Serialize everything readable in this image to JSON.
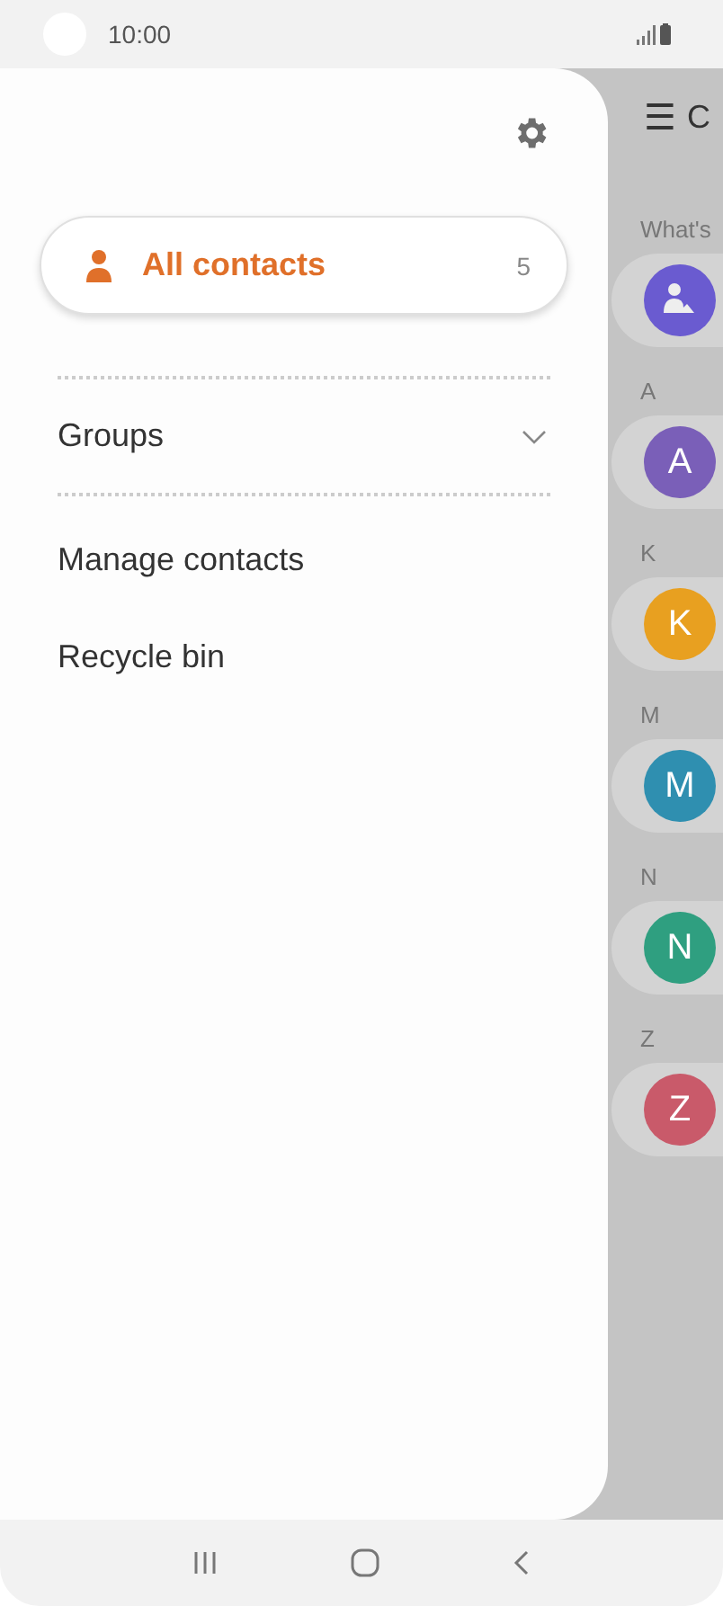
{
  "status_bar": {
    "time": "10:00"
  },
  "drawer": {
    "items": [
      {
        "kind": "main",
        "label": "All contacts",
        "count": "5",
        "selected": true
      },
      {
        "kind": "expandable",
        "label": "Groups",
        "expanded": false,
        "selected": false
      },
      {
        "kind": "plain",
        "label": "Manage contacts",
        "selected": false
      },
      {
        "kind": "plain",
        "label": "Recycle bin",
        "selected": false
      }
    ]
  },
  "contact_list": {
    "menu_icon": "☰",
    "title": "C",
    "sections": [
      {
        "header": "What's",
        "contacts": [
          {
            "kind": "group",
            "color": "#6a5bd0"
          }
        ]
      },
      {
        "header": "A",
        "contacts": [
          {
            "kind": "person",
            "initial": "A",
            "color": "#7a5fb8"
          }
        ]
      },
      {
        "header": "K",
        "contacts": [
          {
            "kind": "person",
            "initial": "K",
            "color": "#e8a020"
          }
        ]
      },
      {
        "header": "M",
        "contacts": [
          {
            "kind": "person",
            "initial": "M",
            "color": "#2f8fb0"
          }
        ]
      },
      {
        "header": "N",
        "contacts": [
          {
            "kind": "person",
            "initial": "N",
            "color": "#2f9f80"
          }
        ]
      },
      {
        "header": "Z",
        "contacts": [
          {
            "kind": "person",
            "initial": "Z",
            "color": "#c95a6a"
          }
        ]
      }
    ]
  }
}
